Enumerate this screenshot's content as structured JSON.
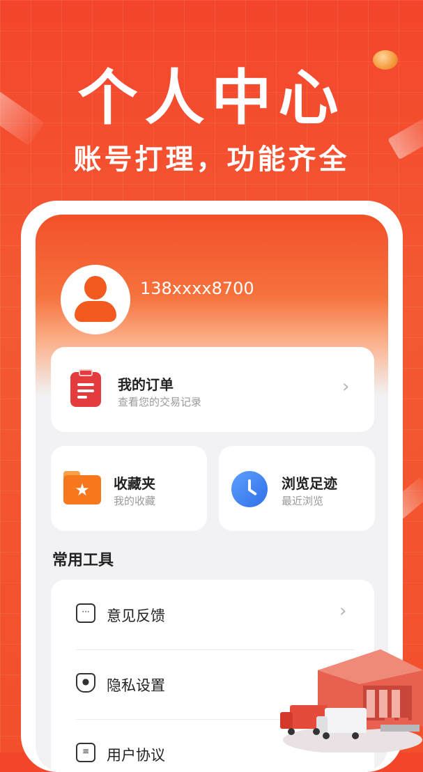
{
  "hero": {
    "title": "个人中心",
    "subtitle": "账号打理，功能齐全"
  },
  "profile": {
    "phone": "138xxxx8700"
  },
  "order": {
    "title": "我的订单",
    "subtitle": "查看您的交易记录"
  },
  "favorites": {
    "title": "收藏夹",
    "subtitle": "我的收藏"
  },
  "history": {
    "title": "浏览足迹",
    "subtitle": "最近浏览"
  },
  "tools": {
    "section_title": "常用工具",
    "items": [
      {
        "label": "意见反馈",
        "icon": "chat-dots-icon"
      },
      {
        "label": "隐私设置",
        "icon": "privacy-shield-icon"
      },
      {
        "label": "用户协议",
        "icon": "clipboard-icon"
      }
    ]
  },
  "colors": {
    "brand": "#f4452c",
    "order_icon": "#e43b3f",
    "folder_icon": "#f7771c",
    "clock_icon": "#2e6fe8"
  }
}
